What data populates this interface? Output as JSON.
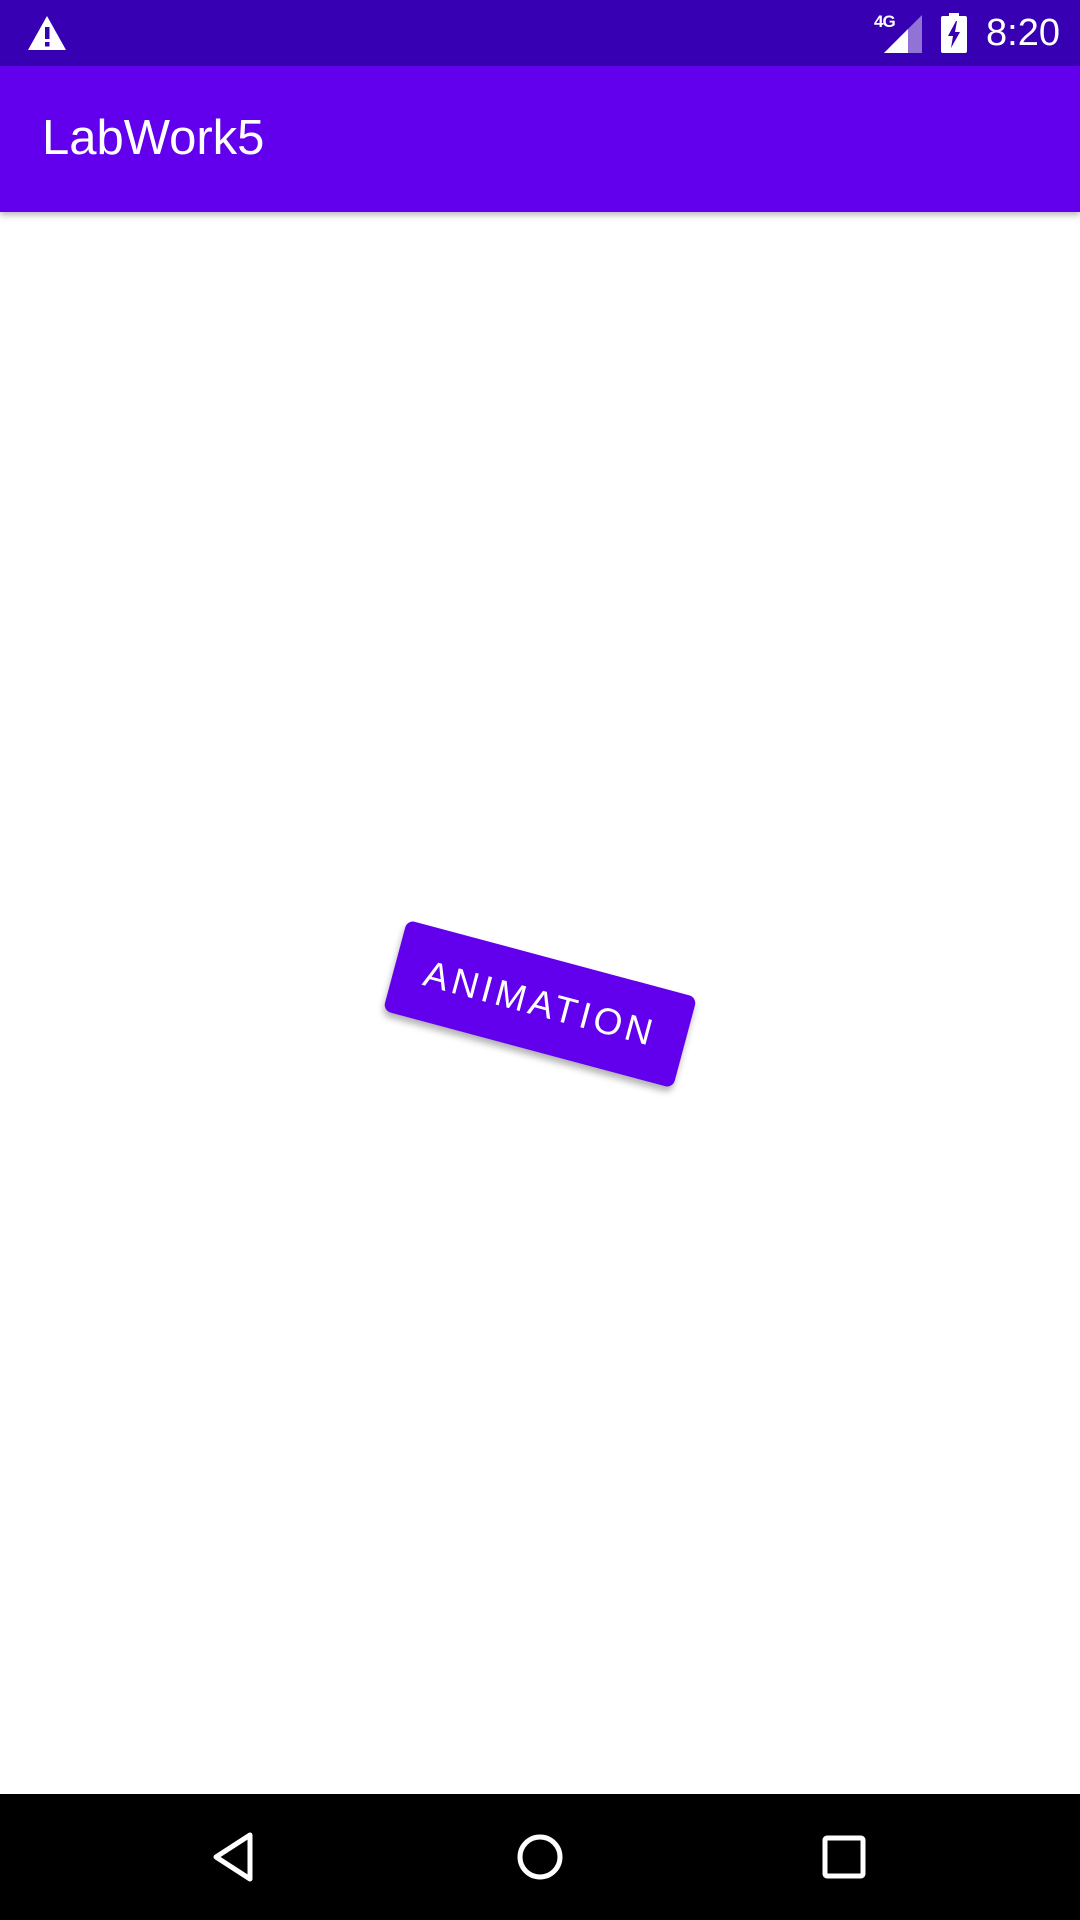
{
  "status_bar": {
    "alert_icon": "warning-icon",
    "network_type": "4G",
    "signal_icon": "cellular-signal-icon",
    "battery_icon": "battery-charging-icon",
    "time": "8:20"
  },
  "app_bar": {
    "title": "LabWork5"
  },
  "main": {
    "animation_button_label": "ANIMATION"
  },
  "nav_bar": {
    "back_icon": "back-icon",
    "home_icon": "home-icon",
    "recents_icon": "recents-icon"
  },
  "colors": {
    "status_bar": "#3700b3",
    "primary": "#6200ee",
    "background": "#ffffff",
    "nav_bar": "#000000",
    "on_primary": "#ffffff"
  }
}
